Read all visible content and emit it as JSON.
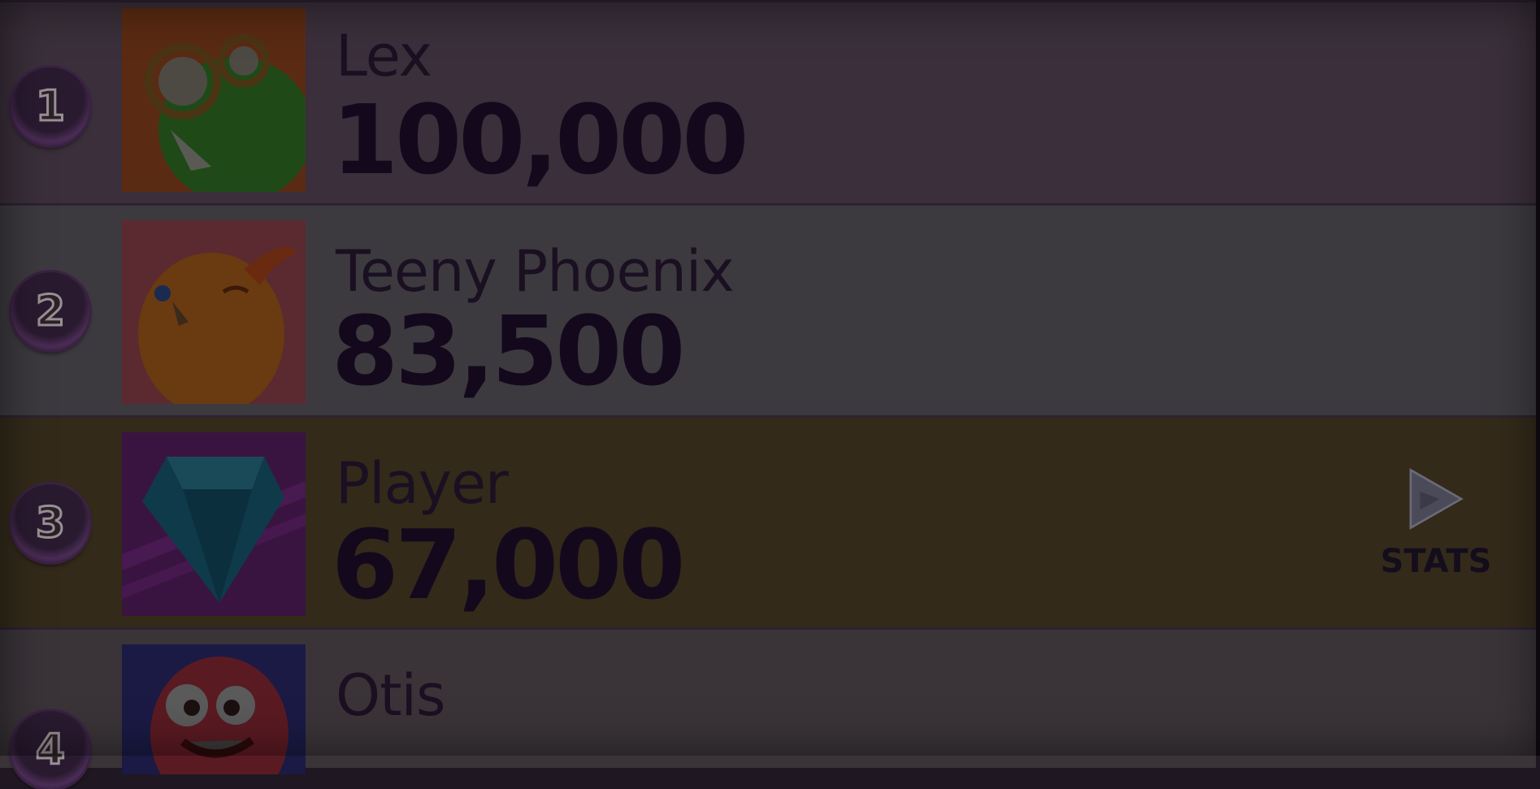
{
  "leaderboard": {
    "entries": [
      {
        "rank": "1",
        "name": "Lex",
        "score": "100,000",
        "avatar_icon": "green-frog-glasses-avatar",
        "highlighted": false
      },
      {
        "rank": "2",
        "name": "Teeny Phoenix",
        "score": "83,500",
        "avatar_icon": "orange-bird-avatar",
        "highlighted": false
      },
      {
        "rank": "3",
        "name": "Player",
        "score": "67,000",
        "avatar_icon": "blue-gem-avatar",
        "highlighted": true
      },
      {
        "rank": "4",
        "name": "Otis",
        "score": "",
        "avatar_icon": "red-monster-avatar",
        "highlighted": false
      }
    ],
    "stats_button_label": "STATS",
    "stats_icon": "play-triangle-icon"
  },
  "colors": {
    "highlight_row": "#332a1a",
    "row": "#3d3a3f",
    "text": "#1a1022"
  }
}
